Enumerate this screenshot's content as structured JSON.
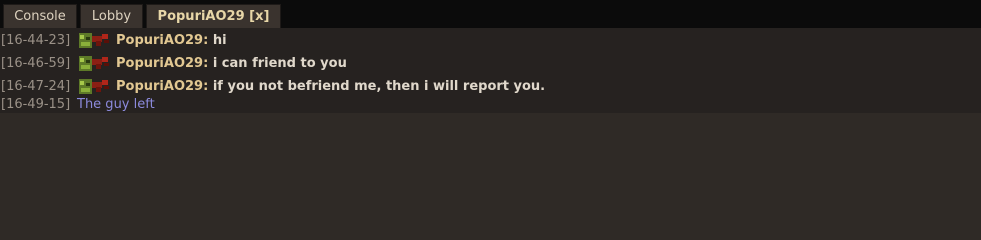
{
  "tabs": [
    {
      "label": "Console",
      "active": false
    },
    {
      "label": "Lobby",
      "active": false
    },
    {
      "label": "PopuriAO29 [x]",
      "active": true
    }
  ],
  "messages": [
    {
      "time": "[16-44-23]",
      "sender": "PopuriAO29:",
      "text": "hi"
    },
    {
      "time": "[16-46-59]",
      "sender": "PopuriAO29:",
      "text": "i can friend to you"
    },
    {
      "time": "[16-47-24]",
      "sender": "PopuriAO29:",
      "text": "if you not befriend me, then i will report you."
    }
  ],
  "system_message": {
    "time": "[16-49-15]",
    "text": "The guy left"
  },
  "colors": {
    "timestamp": "#9a9187",
    "sender": "#e2c892",
    "message": "#e0d8cb",
    "system": "#8c8adc"
  },
  "avatar_icon": "dinosaur-avatar-icon"
}
